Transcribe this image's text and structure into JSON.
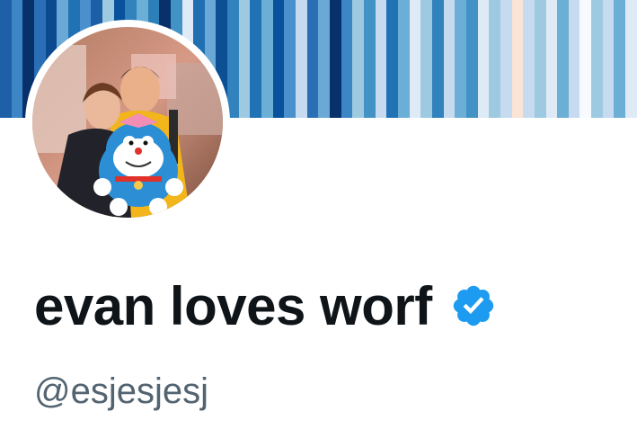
{
  "profile": {
    "display_name": "evan loves worf",
    "handle": "@esjesjesj",
    "verified": true,
    "verified_badge_color": "#1d9bf0",
    "name_color": "#0f1419",
    "handle_color": "#536471"
  },
  "banner": {
    "style": "climate warming stripes",
    "stripe_colors": [
      "#1f5fa8",
      "#3d86c6",
      "#08306b",
      "#2a6fb5",
      "#0b4a8f",
      "#6aa9d6",
      "#2171b5",
      "#4a90cc",
      "#1c5fa6",
      "#9ecae1",
      "#08519c",
      "#3182bd",
      "#6baed6",
      "#2c7fb8",
      "#08306b",
      "#4292c6",
      "#deebf7",
      "#1f6fb2",
      "#6aa9d6",
      "#0d4f93",
      "#3182bd",
      "#9ecae1",
      "#2171b5",
      "#6baed6",
      "#08519c",
      "#4a90cc",
      "#c6dbef",
      "#2a6fb5",
      "#6aa9d6",
      "#08306b",
      "#3d86c6",
      "#9ecae1",
      "#4292c6",
      "#c6dbef",
      "#2171b5",
      "#6baed6",
      "#deebf7",
      "#9ecae1",
      "#3182bd",
      "#c6dbef",
      "#6baed6",
      "#4292c6",
      "#deebf7",
      "#9ecae1",
      "#c6dbef",
      "#fbe3d6",
      "#c6dbef",
      "#9ecae1",
      "#deebf7",
      "#6baed6",
      "#c6dbef",
      "#f7fbff",
      "#9ecae1",
      "#c6dbef",
      "#6baed6",
      "#deebf7"
    ]
  },
  "icons": {
    "avatar": "profile-photo",
    "verified": "verified-badge-icon"
  }
}
